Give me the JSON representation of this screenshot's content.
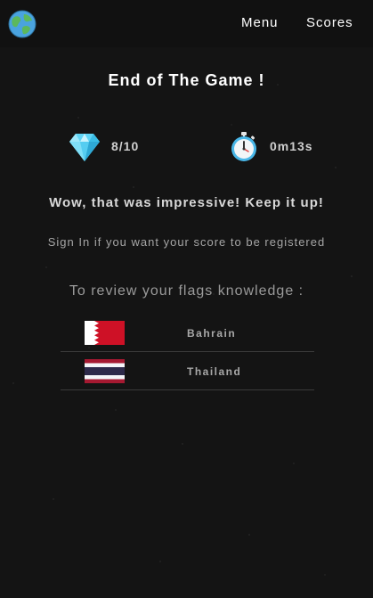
{
  "nav": {
    "logo_icon": "earth-globe-icon",
    "menu_label": "Menu",
    "scores_label": "Scores"
  },
  "result": {
    "title": "End of The Game !",
    "score": "8/10",
    "score_icon": "diamond-icon",
    "time": "0m13s",
    "time_icon": "stopwatch-icon",
    "message": "Wow, that was impressive! Keep it up!",
    "signin_text": "Sign In if you want your score to be registered"
  },
  "review": {
    "heading": "To review your flags knowledge :",
    "flags": [
      {
        "country": "Bahrain",
        "icon": "bahrain-flag-icon"
      },
      {
        "country": "Thailand",
        "icon": "thailand-flag-icon"
      }
    ]
  },
  "colors": {
    "background": "#141414",
    "navbar": "#111111",
    "diamond": "#5fd4f5",
    "stopwatch": "#49b7e8"
  }
}
